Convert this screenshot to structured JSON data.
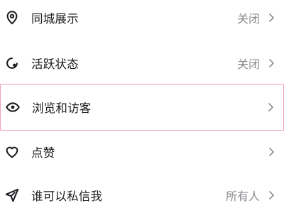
{
  "rows": [
    {
      "icon": "location-pin-icon",
      "label": "同城展示",
      "value": "关闭"
    },
    {
      "icon": "activity-status-icon",
      "label": "活跃状态",
      "value": "关闭"
    },
    {
      "icon": "eye-icon",
      "label": "浏览和访客",
      "value": ""
    },
    {
      "icon": "heart-icon",
      "label": "点赞",
      "value": ""
    },
    {
      "icon": "send-icon",
      "label": "谁可以私信我",
      "value": "所有人"
    }
  ],
  "colors": {
    "text": "#1b1b1f",
    "secondary": "#8a8a8f",
    "highlight_border": "#f0a0bd"
  }
}
